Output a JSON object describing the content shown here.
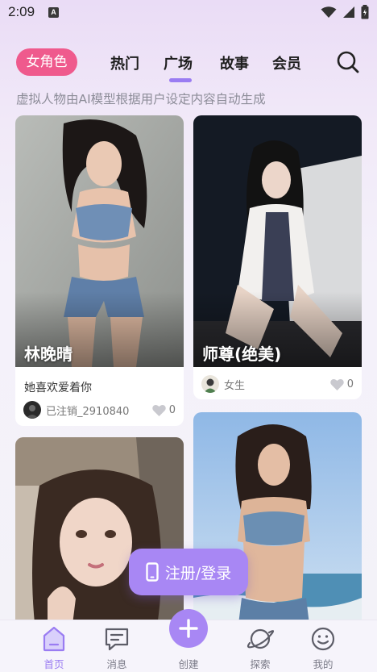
{
  "status_bar": {
    "time": "2:09",
    "notification_letter": "A"
  },
  "header": {
    "category_pill": "女角色",
    "tabs": [
      {
        "label": "热门",
        "active": false
      },
      {
        "label": "广场",
        "active": true
      },
      {
        "label": "故事",
        "active": false
      },
      {
        "label": "会员",
        "active": false
      }
    ],
    "search_icon": "search-icon"
  },
  "subtitle": "虚拟人物由AI模型根据用户设定内容自动生成",
  "cards": [
    {
      "name": "林晚晴",
      "description": "她喜欢爱着你",
      "author": "已注销_2910840",
      "likes": "0"
    },
    {
      "name": "师尊(绝美)",
      "description": "",
      "author": "女生",
      "likes": "0"
    },
    {
      "name": "",
      "description": "",
      "author": "",
      "likes": ""
    },
    {
      "name": "",
      "description": "",
      "author": "",
      "likes": ""
    }
  ],
  "register_button": {
    "label": "注册/登录",
    "icon": "phone-icon"
  },
  "bottom_nav": [
    {
      "label": "首页",
      "icon": "home-icon",
      "active": true
    },
    {
      "label": "消息",
      "icon": "message-icon",
      "active": false
    },
    {
      "label": "创建",
      "icon": "plus-icon",
      "active": false
    },
    {
      "label": "探索",
      "icon": "planet-icon",
      "active": false
    },
    {
      "label": "我的",
      "icon": "smile-icon",
      "active": false
    }
  ],
  "colors": {
    "accent": "#9a7cf2",
    "pill": "#ef5a8d",
    "button": "#a887f4"
  }
}
